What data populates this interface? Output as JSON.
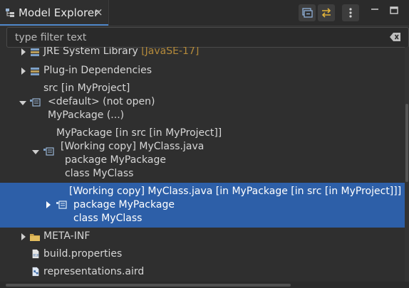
{
  "tab": {
    "title": "Model Explorer",
    "close": "×"
  },
  "filter": {
    "placeholder": "type filter text",
    "value": ""
  },
  "tree": {
    "jre": {
      "label": "JRE System Library",
      "decoration": "[JavaSE-17]"
    },
    "plugin": {
      "label": "Plug-in Dependencies"
    },
    "src": {
      "line1": "src [in MyProject]",
      "line2": "<default> (not open)",
      "line3": "MyPackage (...)"
    },
    "mypackage": {
      "line1": "MyPackage [in src [in MyProject]]",
      "line2": "[Working copy] MyClass.java",
      "line3": "package MyPackage",
      "line4": "class MyClass"
    },
    "selected": {
      "line1": "[Working copy] MyClass.java [in MyPackage [in src [in MyProject]]]",
      "line2": "package MyPackage",
      "line3": "class MyClass"
    },
    "metainf": {
      "label": "META-INF"
    },
    "build": {
      "label": "build.properties"
    },
    "repr": {
      "label": "representations.aird"
    }
  },
  "colors": {
    "selection": "#2d5fa8",
    "accent": "#4d86c8",
    "decoration": "#b48a3a",
    "background": "#2f2f2f"
  }
}
